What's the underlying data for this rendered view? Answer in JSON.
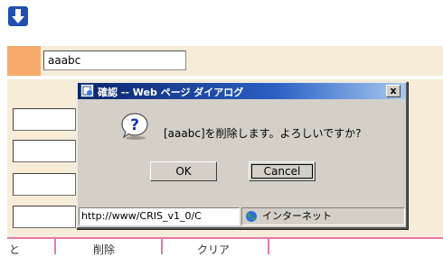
{
  "background_page": {
    "name_input_value": "aaabc",
    "bottom_labels": [
      "と",
      "削除",
      "クリア"
    ]
  },
  "dialog": {
    "title": "確認 -- Web ページ ダイアログ",
    "close_label": "x",
    "message": "[aaabc]を削除します。よろしいですか?",
    "ok_label": "OK",
    "cancel_label": "Cancel",
    "status_url": "http://www/CRIS_v1_0/C",
    "zone_label": "インターネット"
  },
  "icons": {
    "top": "arrow-down-icon",
    "dialog": "question-icon",
    "zone": "globe-icon"
  },
  "colors": {
    "page_background": "#f6ecd7",
    "accent_cell": "#f7a96b",
    "titlebar_start": "#0a246a",
    "titlebar_end": "#a6caf0",
    "grid_lines": "#e07ab0"
  }
}
